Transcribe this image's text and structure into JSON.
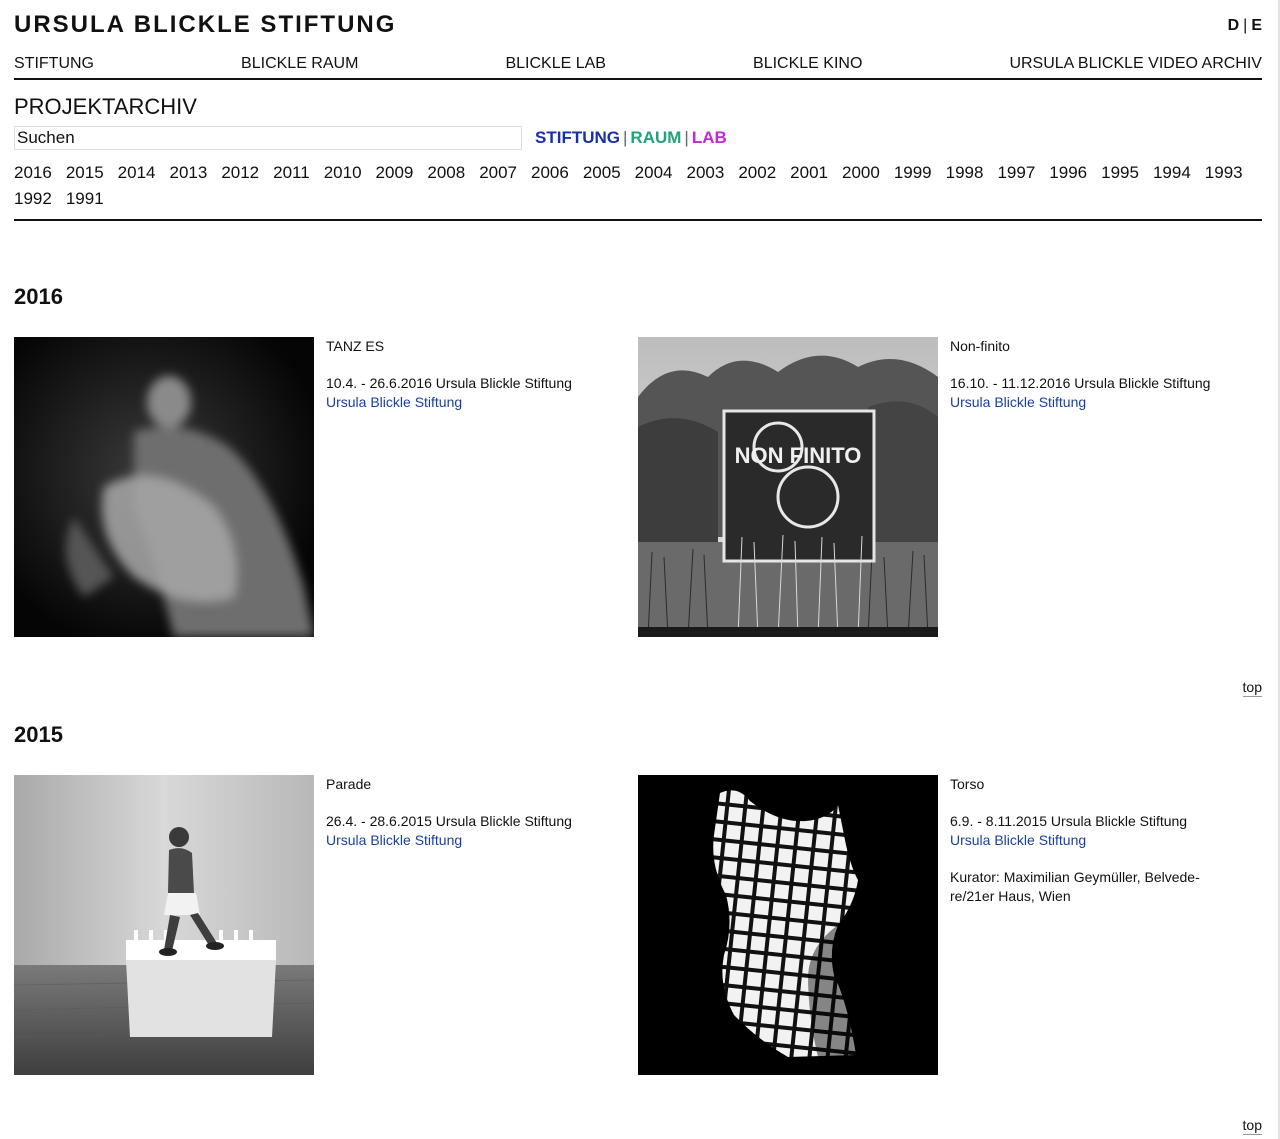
{
  "header": {
    "logo": "URSULA BLICKLE STIFTUNG",
    "lang": [
      "D",
      "E"
    ],
    "nav": [
      "STIFTUNG",
      "BLICKLE RAUM",
      "BLICKLE LAB",
      "BLICKLE KINO",
      "URSULA BLICKLE VIDEO ARCHIV"
    ]
  },
  "archive": {
    "title": "PROJEKTARCHIV",
    "search_placeholder": "Suchen",
    "filters": [
      {
        "label": "STIFTUNG",
        "color": "#1a2fa8"
      },
      {
        "label": "RAUM",
        "color": "#1fa37a"
      },
      {
        "label": "LAB",
        "color": "#c02ad6"
      }
    ],
    "years": [
      "2016",
      "2015",
      "2014",
      "2013",
      "2012",
      "2011",
      "2010",
      "2009",
      "2008",
      "2007",
      "2006",
      "2005",
      "2004",
      "2003",
      "2002",
      "2001",
      "2000",
      "1999",
      "1998",
      "1997",
      "1996",
      "1995",
      "1994",
      "1993",
      "1992",
      "1991"
    ]
  },
  "sections": [
    {
      "year": "2016",
      "items": [
        {
          "title": "TANZ ES",
          "date": "10.4. - 26.6.2016 Ursula Blickle Stiftung",
          "venue": "Ursula Blickle Stiftung",
          "image": "dancer-photo"
        },
        {
          "title": "Non-finito",
          "date": "16.10. - 11.12.2016 Ursula Blickle Stiftung",
          "venue": "Ursula Blickle Stiftung",
          "image": "non-finito-sign-photo",
          "image_text": "NON FINITO"
        }
      ],
      "top_label": "top"
    },
    {
      "year": "2015",
      "items": [
        {
          "title": "Parade",
          "date": "26.4. - 28.6.2015 Ursula Blickle Stiftung",
          "venue": "Ursula Blickle Stiftung",
          "image": "man-on-light-box-photo"
        },
        {
          "title": "Torso",
          "date": "6.9. - 8.11.2015 Ursula Blickle Stiftung",
          "venue": "Ursula Blickle Stiftung",
          "curator": "Kurator: Maximilian Geymüller, Belvede-re/21er Haus, Wien",
          "image": "grid-torso-photo"
        }
      ],
      "top_label": "top"
    }
  ]
}
